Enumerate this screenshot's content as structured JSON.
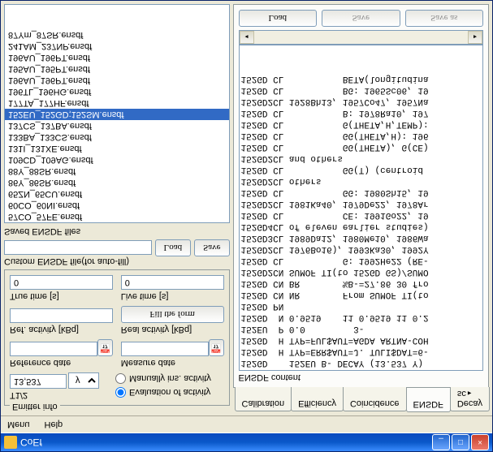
{
  "window": {
    "title": "CoEf"
  },
  "menu": {
    "menu": "Menu",
    "help": "Help"
  },
  "emitter": {
    "group": "Emitter info",
    "halflife_label": "T1/2",
    "halflife_value": "13,537",
    "halflife_unit": "y",
    "radio_eval": "Evaluation of activity",
    "radio_manual": "Manually ins. activity",
    "ref_date": "Reference date",
    "meas_date": "Measure date",
    "ref_act": "Ref. activity [kBq]",
    "real_act": "Real activity [kBq]",
    "fill_btn": "Fill the form",
    "true_time": "True time [s]",
    "live_time": "Live time [s]",
    "true_val": "0",
    "live_val": "0"
  },
  "custom": {
    "label": "Custom ENSDF file(for auto-fill)",
    "load": "Load",
    "save": "Save"
  },
  "saved": {
    "label": "Saved ENSDF files",
    "items": [
      "57CO_57FE.ensdf",
      "60CO_60NI.ensdf",
      "65ZN_65CU.ensdf",
      "86Y_86SR.ensdf",
      "88Y_88SR.ensdf",
      "109CD_109AG.ensdf",
      "131I_131XE.ensdf",
      "133BA_133CS.ensdf",
      "137CS_137BA.ensdf",
      "152EU_152GD;152SM.ensdf",
      "177TA_177HF.ensdf",
      "196TL_196HG.ensdf",
      "196AU_196PT.ensdf",
      "195AU_195PT.ensdf",
      "196AU_196PT.ensdf",
      "241AM_237NP.ensdf",
      "87Ym_87SR.ensdf"
    ],
    "selected_index": 9
  },
  "tabs": {
    "t1": "Calibration",
    "t2": "Efficiency",
    "t3": "Coincidence",
    "t4": "ENSDF",
    "t5": "Decay sc"
  },
  "ensdf": {
    "label": "ENSDF content",
    "lines": [
      "152GD    152EU B- DECAY (13.537 Y)",
      "152GD  H TYP=ERR$AUT=J. TULI$DAT=6-",
      "152GD  H TYP=FUL$AUT=AGDA ARTNA-COH",
      "152EU  P 0.0         3-",
      "152GD  N 0.9519    11 0.9519 11 0.2",
      "152GD PN",
      "152GD CN NR        From SUMOF TI(to",
      "152GD CN BR        %B-=27.86 30 fro",
      "152GD2CN SUMOF TI(to 152GD GS)/SUMO",
      "152GD CL           G: 1992He22 (RE-",
      "152GD2CL 1976Bo16), 1993Ka30, 1992Y",
      "152GD3CL 1989Da12, 1980Me10, 1986Wa",
      "152GD4CL of eleven earlier studies)",
      "152GD CL           CE: 1991Go22, 19",
      "152GD2CL 1981Ka40, 1979De22, 1978Ar",
      "152GD CL           GG: 1980Sh15, 19",
      "152GD2CL others",
      "152GD CL           GG(T) (centroid ",
      "152GD2CL and others",
      "152GD CL           GG(THETA), G(CE)",
      "152GD CL           GG(THETA,H): 196",
      "152GD CL           G(THETA,H,TEMP):",
      "152GD CL           B: 1978Ra10, 197",
      "152GD2CL 1928Bh13, 1957Co47, 1957Na",
      "152GD CL           BG: 1965Sc06, 19",
      "152GD CL           BETA(longitudina"
    ],
    "load": "Load",
    "save": "Save",
    "saveas": "Save as"
  }
}
